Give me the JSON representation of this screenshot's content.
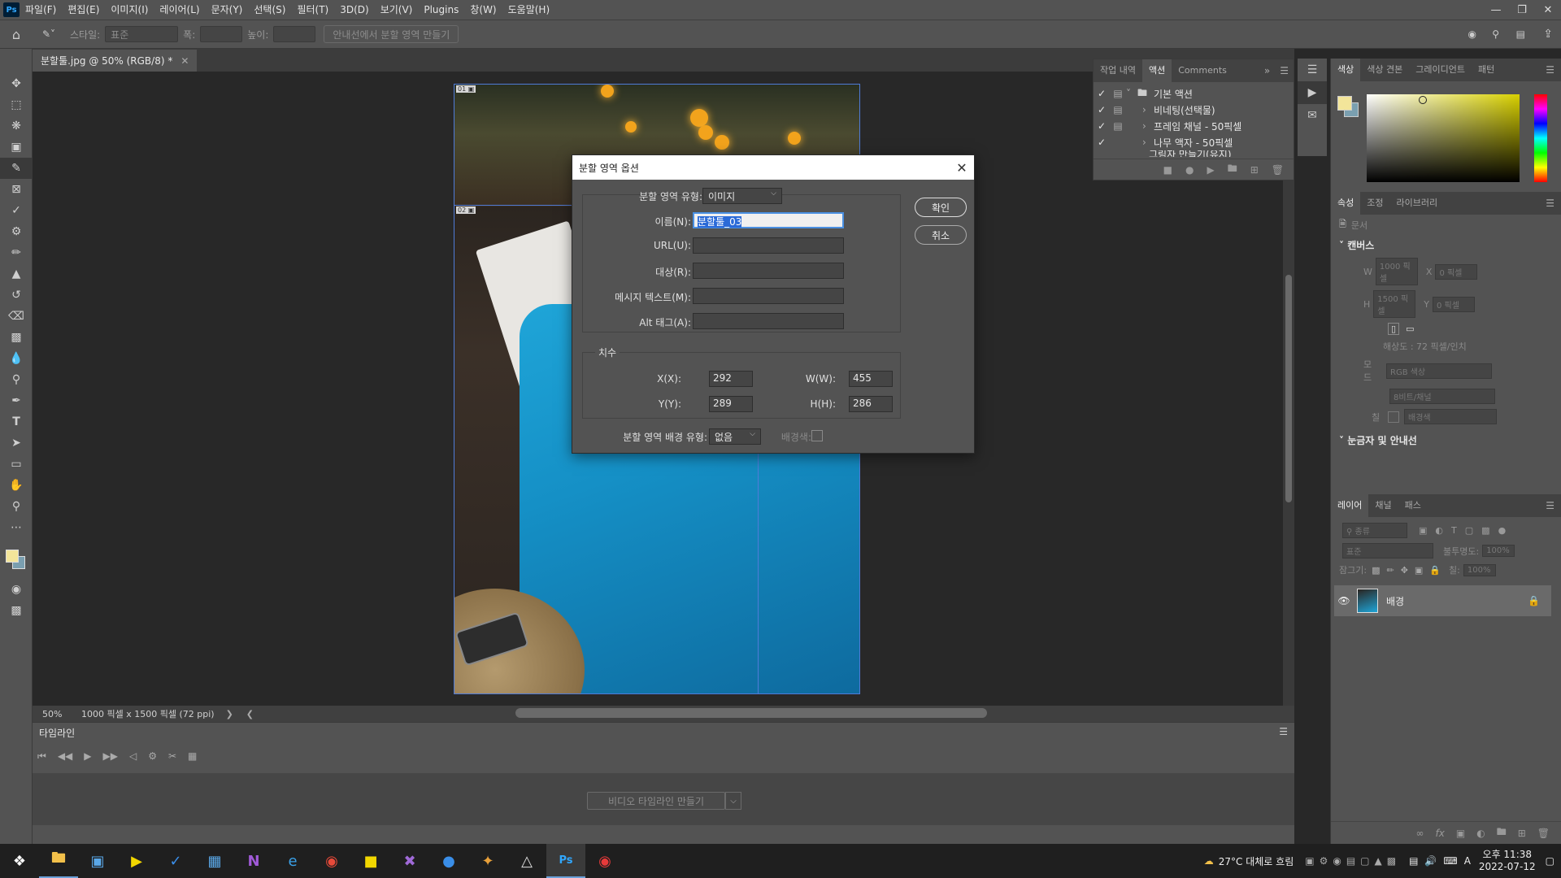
{
  "menu": {
    "app_icon": "Ps",
    "items": [
      "파일(F)",
      "편집(E)",
      "이미지(I)",
      "레이어(L)",
      "문자(Y)",
      "선택(S)",
      "필터(T)",
      "3D(D)",
      "보기(V)",
      "Plugins",
      "창(W)",
      "도움말(H)"
    ]
  },
  "options": {
    "style_label": "스타일:",
    "style_value": "표준",
    "width_label": "폭:",
    "height_label": "높이:",
    "guide_button": "안내선에서 분할 영역 만들기"
  },
  "document": {
    "tab_title": "분할툴.jpg @ 50% (RGB/8) *",
    "zoom": "50%",
    "doc_info": "1000 픽셀 x 1500 픽셀 (72 ppi)"
  },
  "timeline": {
    "tab": "타임라인",
    "create_button": "비디오 타임라인 만들기"
  },
  "actions_panel": {
    "tabs": [
      "작업 내역",
      "액션",
      "Comments"
    ],
    "active_tab": "액션",
    "items": [
      {
        "label": "기본 액션",
        "folder": true,
        "expanded": true
      },
      {
        "label": "비네팅(선택물)",
        "folder": false
      },
      {
        "label": "프레임 채널 - 50픽셀",
        "folder": false
      },
      {
        "label": "나무 액자 - 50픽셀",
        "folder": false
      },
      {
        "label": "그림자 만들기(유지)",
        "folder": false
      }
    ]
  },
  "color_panel": {
    "tabs": [
      "색상",
      "색상 견본",
      "그레이디언트",
      "패턴"
    ],
    "foreground": "#f3e59a",
    "background": "#7a9fb0",
    "hue": "#d8d000"
  },
  "properties_panel": {
    "tabs": [
      "속성",
      "조정",
      "라이브러리"
    ],
    "doc_label": "문서",
    "canvas_title": "캔버스",
    "w_label": "W",
    "w_value": "1000 픽셀",
    "h_label": "H",
    "h_value": "1500 픽셀",
    "x_label": "X",
    "x_value": "0 픽셀",
    "y_label": "Y",
    "y_value": "0 픽셀",
    "resolution": "해상도 : 72 픽셀/인치",
    "mode_label": "모드",
    "mode_value": "RGB 색상",
    "depth_value": "8비트/채널",
    "fill_label": "칠",
    "fill_value": "배경색",
    "rulers_title": "눈금자 및 안내선"
  },
  "layers_panel": {
    "tabs": [
      "레이어",
      "채널",
      "패스"
    ],
    "search": "종류",
    "blend_mode": "표준",
    "opacity_label": "불투명도:",
    "opacity_value": "100%",
    "lock_label": "잠그기:",
    "fill_label": "칠:",
    "fill_value": "100%",
    "layer_name": "배경"
  },
  "dialog": {
    "title": "분할 영역 옵션",
    "slice_type_label": "분할 영역 유형:",
    "slice_type_value": "이미지",
    "name_label": "이름(N):",
    "name_value": "분할툴_03",
    "url_label": "URL(U):",
    "target_label": "대상(R):",
    "message_label": "메시지 텍스트(M):",
    "alt_label": "Alt 태그(A):",
    "dimensions_title": "치수",
    "x_label": "X(X):",
    "x_value": "292",
    "y_label": "Y(Y):",
    "y_value": "289",
    "w_label": "W(W):",
    "w_value": "455",
    "h_label": "H(H):",
    "h_value": "286",
    "bg_type_label": "분할 영역 배경 유형:",
    "bg_type_value": "없음",
    "bg_color_label": "배경색:",
    "ok_label": "확인",
    "cancel_label": "취소"
  },
  "taskbar": {
    "weather": "27°C  대체로 흐림",
    "lang": "A",
    "time": "오후 11:38",
    "date": "2022-07-12"
  }
}
